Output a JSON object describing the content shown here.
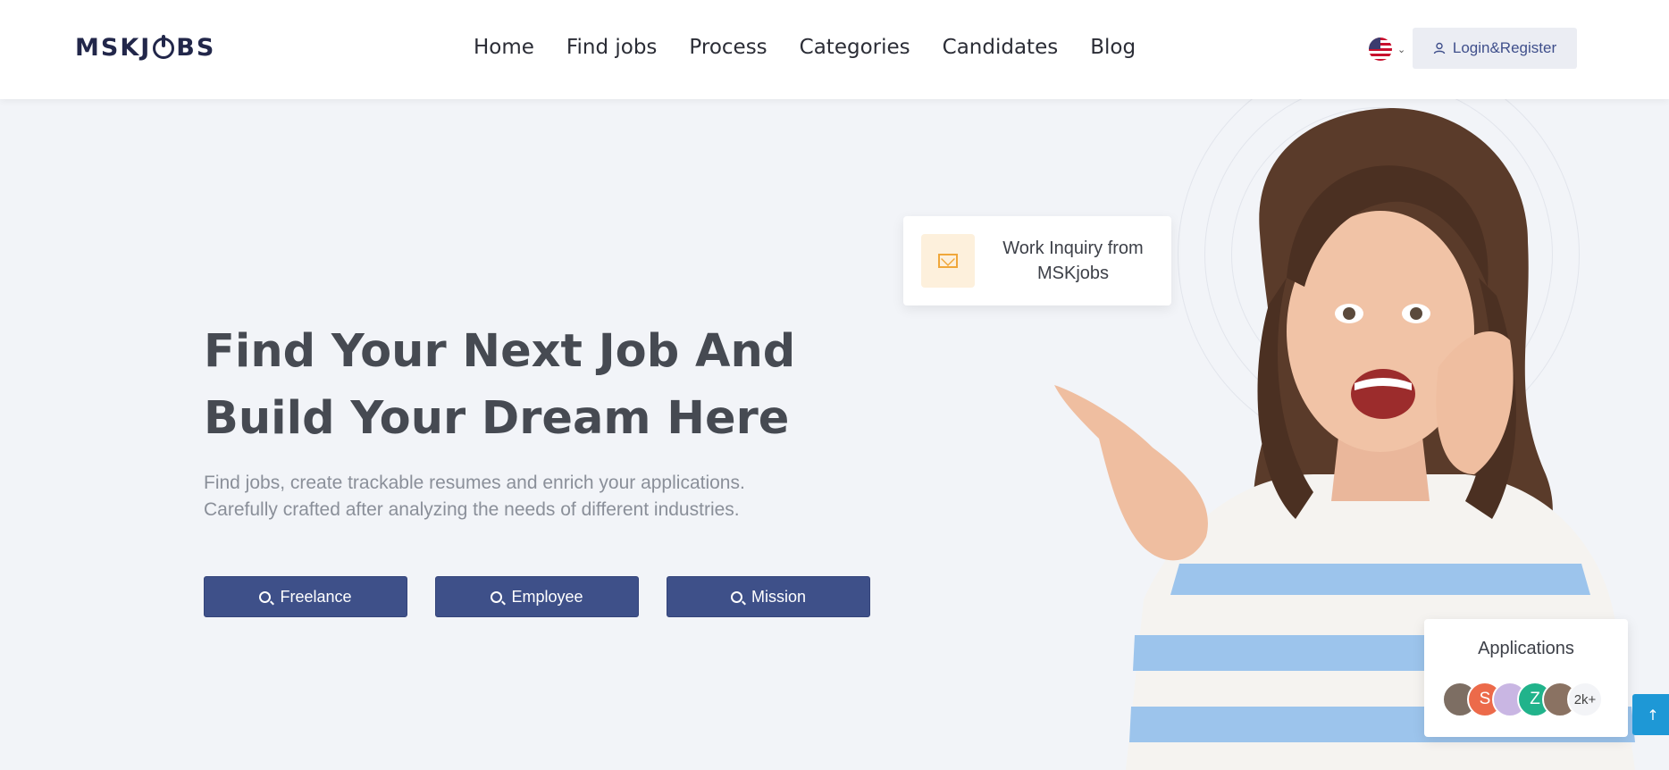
{
  "header": {
    "logo": {
      "left": "MSK",
      "mid": "J",
      "right": "BS"
    },
    "nav": [
      "Home",
      "Find jobs",
      "Process",
      "Categories",
      "Candidates",
      "Blog"
    ],
    "language": "en-US",
    "login_label": "Login&Register"
  },
  "hero": {
    "title_line1": "Find Your Next Job And",
    "title_line2": "Build Your Dream Here",
    "subtitle_line1": "Find jobs, create trackable resumes and enrich your applications.",
    "subtitle_line2": "Carefully crafted after analyzing the needs of different industries.",
    "buttons": [
      "Freelance",
      "Employee",
      "Mission"
    ]
  },
  "inquiry_card": {
    "line1": "Work Inquiry from",
    "line2": "MSKjobs"
  },
  "applications_card": {
    "title": "Applications",
    "avatars": [
      {
        "initial": "",
        "color": "#7d6e63"
      },
      {
        "initial": "S",
        "color": "#ec6a4a"
      },
      {
        "initial": "",
        "color": "#c9b6e3"
      },
      {
        "initial": "Z",
        "color": "#21b38b"
      },
      {
        "initial": "",
        "color": "#8a7262"
      }
    ],
    "count": "2k+"
  },
  "colors": {
    "primary": "#3e5089",
    "background": "#f2f4f8",
    "accent_blue": "#1e98d6",
    "inquiry_icon_bg": "#fdf0dc"
  },
  "icons": {
    "scroll_top": "arrow-up-icon",
    "login": "user-icon",
    "search": "search-icon",
    "mail": "mail-icon"
  }
}
